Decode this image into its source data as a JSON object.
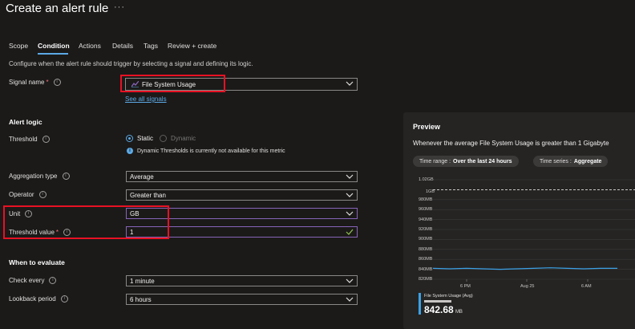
{
  "header": {
    "title": "Create an alert rule",
    "more": "···"
  },
  "tabs": [
    "Scope",
    "Condition",
    "Actions",
    "Details",
    "Tags",
    "Review + create"
  ],
  "description": "Configure when the alert rule should trigger by selecting a signal and defining its logic.",
  "signal": {
    "label": "Signal name",
    "value": "File System Usage",
    "see_all": "See all signals"
  },
  "alert_logic": {
    "heading": "Alert logic",
    "threshold_label": "Threshold",
    "static_label": "Static",
    "dynamic_label": "Dynamic",
    "dynamic_note": "Dynamic Thresholds is currently not available for this metric",
    "aggregation_label": "Aggregation type",
    "aggregation_value": "Average",
    "operator_label": "Operator",
    "operator_value": "Greater than",
    "unit_label": "Unit",
    "unit_value": "GB",
    "threshold_value_label": "Threshold value",
    "threshold_value": "1"
  },
  "evaluate": {
    "heading": "When to evaluate",
    "check_every_label": "Check every",
    "check_every_value": "1 minute",
    "lookback_label": "Lookback period",
    "lookback_value": "6 hours"
  },
  "preview": {
    "title": "Preview",
    "summary": "Whenever the average File System Usage is greater than 1 Gigabyte",
    "time_range_key": "Time range :",
    "time_range_value": "Over the last 24 hours",
    "time_series_key": "Time series :",
    "time_series_value": "Aggregate",
    "legend_name": "File System Usage (Avg)",
    "legend_value": "842.68",
    "legend_unit": "MB",
    "threshold_line_label": "1GB"
  },
  "chart_data": {
    "type": "line",
    "y_ticks": [
      "1.02GB",
      "1GB",
      "980MB",
      "960MB",
      "940MB",
      "920MB",
      "900MB",
      "880MB",
      "860MB",
      "840MB",
      "820MB"
    ],
    "x_ticks": [
      "6 PM",
      "Aug 25",
      "6 AM"
    ],
    "ylim_mb": [
      820,
      1040
    ],
    "threshold_mb": 1024,
    "series": [
      {
        "name": "File System Usage (Avg)",
        "color": "#3ba1e6",
        "values_mb": [
          842,
          841,
          842,
          841,
          840,
          841,
          842,
          843,
          842,
          841,
          842,
          842
        ]
      }
    ]
  },
  "colors": {
    "accent": "#5ca9e5",
    "highlight": "#e81123",
    "line": "#3ba1e6",
    "valid": "#8764b8"
  }
}
